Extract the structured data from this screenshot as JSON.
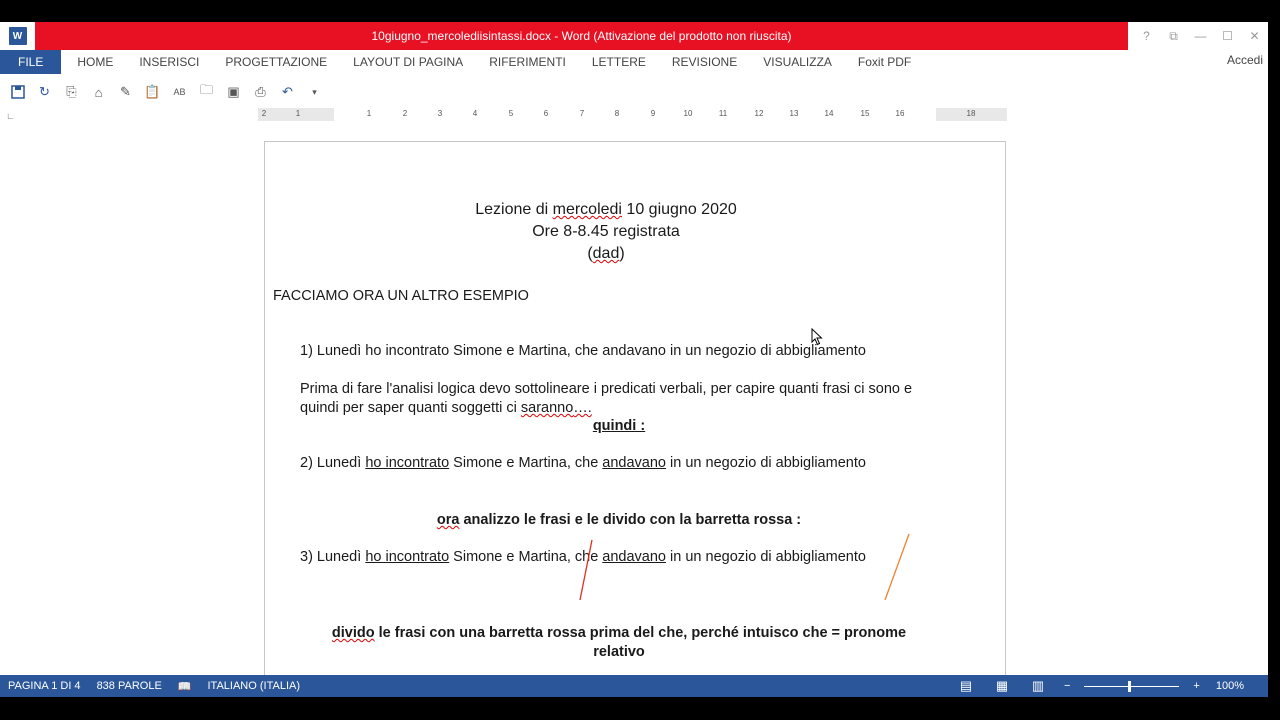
{
  "window": {
    "title": "10giugno_mercolediisintassi.docx -  Word (Attivazione del prodotto non riuscita)",
    "app_icon": "word-icon",
    "controls": [
      "?",
      "⧉",
      "—",
      "☐",
      "✕"
    ]
  },
  "ribbon": {
    "tabs": [
      "FILE",
      "HOME",
      "INSERISCI",
      "PROGETTAZIONE",
      "LAYOUT DI PAGINA",
      "RIFERIMENTI",
      "LETTERE",
      "REVISIONE",
      "VISUALIZZA",
      "Foxit PDF"
    ],
    "signin": "Accedi"
  },
  "qat": {
    "icons": [
      "save-icon",
      "redo-icon",
      "copy-icon",
      "stamp-icon",
      "edit-icon",
      "paste-icon",
      "spelling-icon",
      "folder-icon",
      "layout-icon",
      "print-icon",
      "undo-icon",
      "customize-icon"
    ]
  },
  "ruler": {
    "labels": [
      "2",
      "1",
      "1",
      "2",
      "3",
      "4",
      "5",
      "6",
      "7",
      "8",
      "9",
      "10",
      "11",
      "12",
      "13",
      "14",
      "15",
      "16",
      "18"
    ],
    "corner": "∟"
  },
  "document": {
    "heading": {
      "line1_pre": "Lezione di ",
      "line1_sq": "mercoledi",
      "line1_post": " 10 giugno 2020",
      "line2": "Ore 8-8.45 registrata",
      "line3_pre": "(",
      "line3_sq": "dad",
      "line3_post": ")"
    },
    "intro": "FACCIAMO ORA UN ALTRO ESEMPIO",
    "item1": "1)  Lunedì ho incontrato Simone e Martina, che andavano in un negozio di abbigliamento",
    "para1_line1": "Prima di fare l'analisi logica devo sottolineare i predicati verbali, per capire quanti frasi ci sono e",
    "para1_line2_pre": "quindi per saper quanti soggetti ci ",
    "para1_line2_sq": "saranno",
    "para1_line2_dots": "….",
    "quindi": "quindi :",
    "item2": {
      "num": "2)  Lunedì ",
      "verb1": "ho incontrato",
      "mid": " Simone e Martina, che ",
      "verb2": "andavano",
      "end": " in un negozio di abbigliamento"
    },
    "analysis_sq": "ora",
    "analysis_rest": " analizzo le frasi e le divido con la barretta rossa :",
    "item3": {
      "num": "3)  Lunedì ",
      "verb1": "ho incontrato",
      "mid1": " Simone e Martina,",
      "mid2": " che ",
      "verb2": "andavano",
      "end": " in un negozio di abbigliamento"
    },
    "final_sq": "divido",
    "final_rest": " le frasi con una barretta rossa prima del che, perché intuisco che  = pronome",
    "final_line2": "relativo"
  },
  "status": {
    "page": "PAGINA 1 DI 4",
    "words": "838 PAROLE",
    "lang": "ITALIANO (ITALIA)",
    "zoom_minus": "−",
    "zoom_plus": "+",
    "zoom": "100%",
    "zoom_level": 1.0
  },
  "colors": {
    "accent": "#2b579a",
    "title_bar": "#e81123",
    "divider_line": "#e0301e",
    "divider_line2": "#f08030"
  }
}
